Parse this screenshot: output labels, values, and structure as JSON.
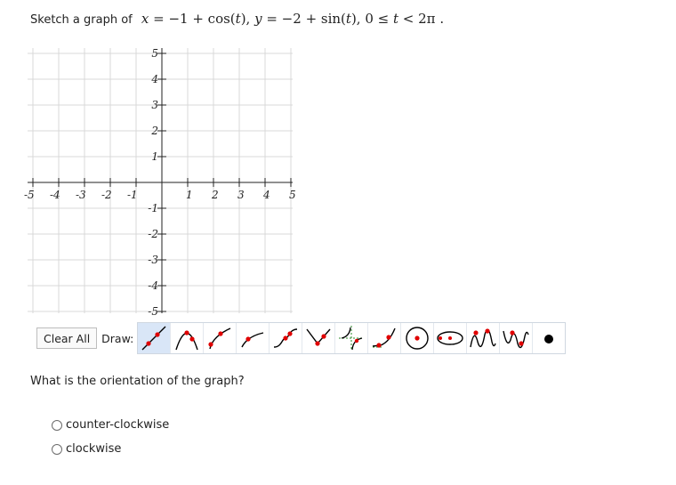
{
  "prompt": {
    "text": "Sketch a graph of",
    "equation_parts": {
      "x_var": "x",
      "x_expr": " = −1 + cos(",
      "t1": "t",
      "sep1": "), ",
      "y_var": "y",
      "y_expr": " = −2 + sin(",
      "t2": "t",
      "sep2": "), 0 ≤ ",
      "t3": "t",
      "range_end": " < 2π",
      "period": "  ."
    }
  },
  "graph": {
    "x_range": [
      -5,
      5
    ],
    "y_range": [
      -5,
      5
    ],
    "grid": true,
    "x_ticks": [
      "-5",
      "-4",
      "-3",
      "-2",
      "-1",
      "1",
      "2",
      "3",
      "4",
      "5"
    ],
    "y_ticks": [
      "5",
      "4",
      "3",
      "2",
      "1",
      "-1",
      "-2",
      "-3",
      "-4",
      "-5"
    ],
    "grid_color": "#d9d9d9",
    "axis_color": "#222222"
  },
  "toolbar": {
    "clear_label": "Clear All",
    "draw_label": "Draw:",
    "tools": [
      "line-tool-icon",
      "parabola-tool-icon",
      "sqrt-tool-icon",
      "log-tool-icon",
      "cubic-tool-icon",
      "absolute-value-tool-icon",
      "rational-tool-icon",
      "exponential-tool-icon",
      "circle-tool-icon",
      "ellipse-tool-icon",
      "sine-tool-icon",
      "cosine-tool-icon",
      "point-tool-icon"
    ],
    "selected_tool": "line-tool-icon",
    "accent_color": "#e00000"
  },
  "question": {
    "text": "What is the orientation of the graph?",
    "options": [
      "counter-clockwise",
      "clockwise"
    ]
  }
}
